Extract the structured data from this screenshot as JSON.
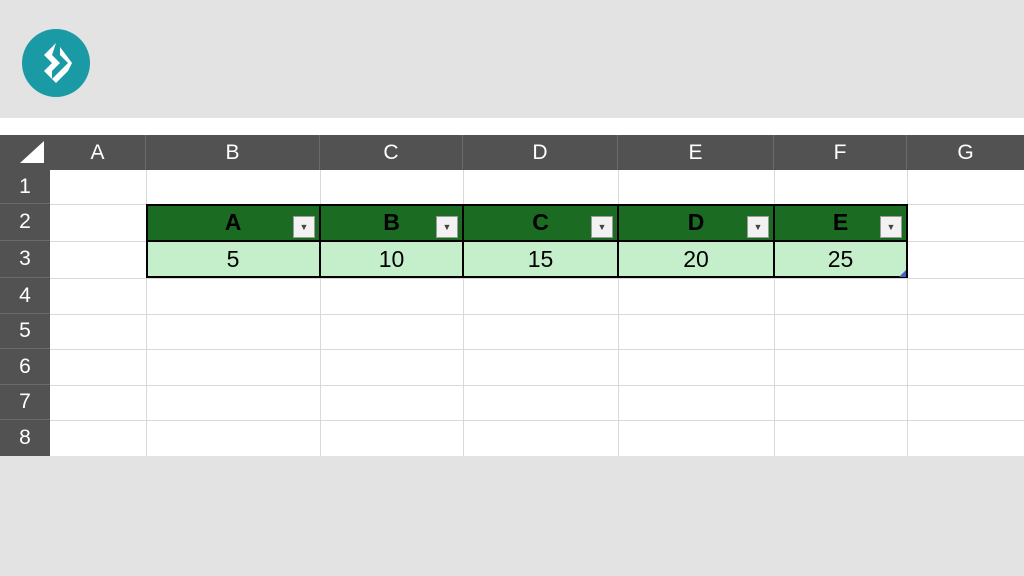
{
  "columns": [
    "A",
    "B",
    "C",
    "D",
    "E",
    "F",
    "G"
  ],
  "rows": [
    "1",
    "2",
    "3",
    "4",
    "5",
    "6",
    "7",
    "8"
  ],
  "table": {
    "headers": [
      "A",
      "B",
      "C",
      "D",
      "E"
    ],
    "values": [
      "5",
      "10",
      "15",
      "20",
      "25"
    ],
    "header_color": "#1b6b22",
    "body_color": "#c5efcb"
  },
  "icons": {
    "logo": "brand-logo-icon",
    "filter": "filter-dropdown-icon",
    "select_all": "select-all-triangle-icon"
  },
  "filter_glyph": "▼"
}
